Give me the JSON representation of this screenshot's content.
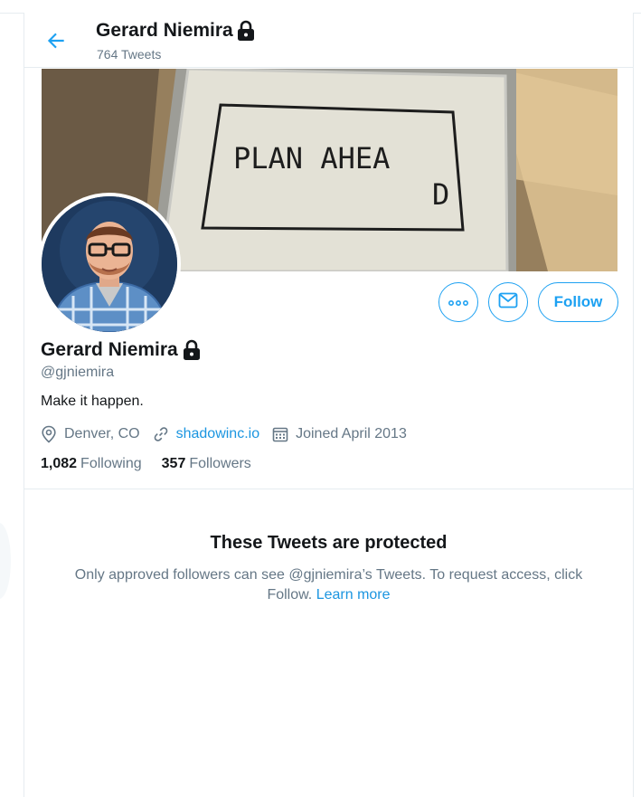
{
  "header": {
    "back_icon": "arrow-left-icon",
    "name": "Gerard Niemira",
    "lock_icon": "lock-icon",
    "tweets_count": "764 Tweets"
  },
  "banner": {
    "description": "cross-stitch sampler photo",
    "stitched_text_line1": "PLAN AHEA",
    "stitched_text_line2": "D"
  },
  "actions": {
    "more_icon": "more-dots-icon",
    "message_icon": "envelope-icon",
    "follow_label": "Follow"
  },
  "profile": {
    "name": "Gerard Niemira",
    "handle": "@gjniemira",
    "bio": "Make it happen.",
    "location": "Denver, CO",
    "website": "shadowinc.io",
    "joined": "Joined April 2013",
    "following_count": "1,082",
    "following_label": "Following",
    "followers_count": "357",
    "followers_label": "Followers"
  },
  "protected": {
    "title": "These Tweets are protected",
    "body": "Only approved followers can see @gjniemira’s Tweets. To request access, click Follow.",
    "learn_more": "Learn more"
  },
  "colors": {
    "accent": "#1da1f2",
    "link": "#1b95e0",
    "secondary_text": "#657786",
    "primary_text": "#14171a",
    "border": "#e6ecf0"
  }
}
